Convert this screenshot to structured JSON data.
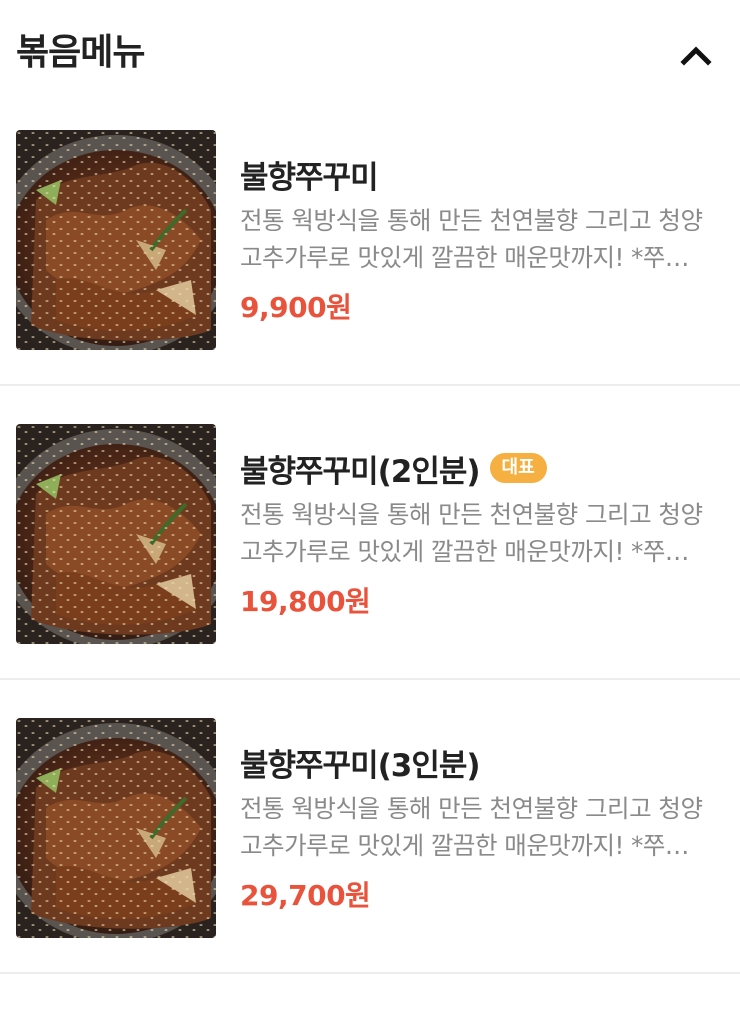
{
  "section": {
    "title": "볶음메뉴",
    "toggle_icon": "chevron-up-icon"
  },
  "colors": {
    "price": "#e9533c",
    "badge_bg": "#f5b041",
    "description": "#8a8a8a",
    "divider": "#ececec"
  },
  "items": [
    {
      "name": "불향쭈꾸미",
      "badge": "",
      "description": "전통 웍방식을 통해 만든 천연불향 그리고 청양고추가루로 맛있게 깔끔한 매운맛까지! *쭈꾸미는 국내산이 아닙니다.",
      "price": "9,900원",
      "image": "spicy-webfoot-octopus-photo"
    },
    {
      "name": "불향쭈꾸미(2인분)",
      "badge": "대표",
      "description": "전통 웍방식을 통해 만든 천연불향 그리고 청양고추가루로 맛있게 깔끔한 매운맛까지! *쭈꾸미는 국내산이 아닙니다.",
      "price": "19,800원",
      "image": "spicy-webfoot-octopus-photo"
    },
    {
      "name": "불향쭈꾸미(3인분)",
      "badge": "",
      "description": "전통 웍방식을 통해 만든 천연불향 그리고 청양고추가루로 맛있게 깔끔한 매운맛까지! *쭈꾸미는 국내산이 아닙니다.",
      "price": "29,700원",
      "image": "spicy-webfoot-octopus-photo"
    }
  ]
}
